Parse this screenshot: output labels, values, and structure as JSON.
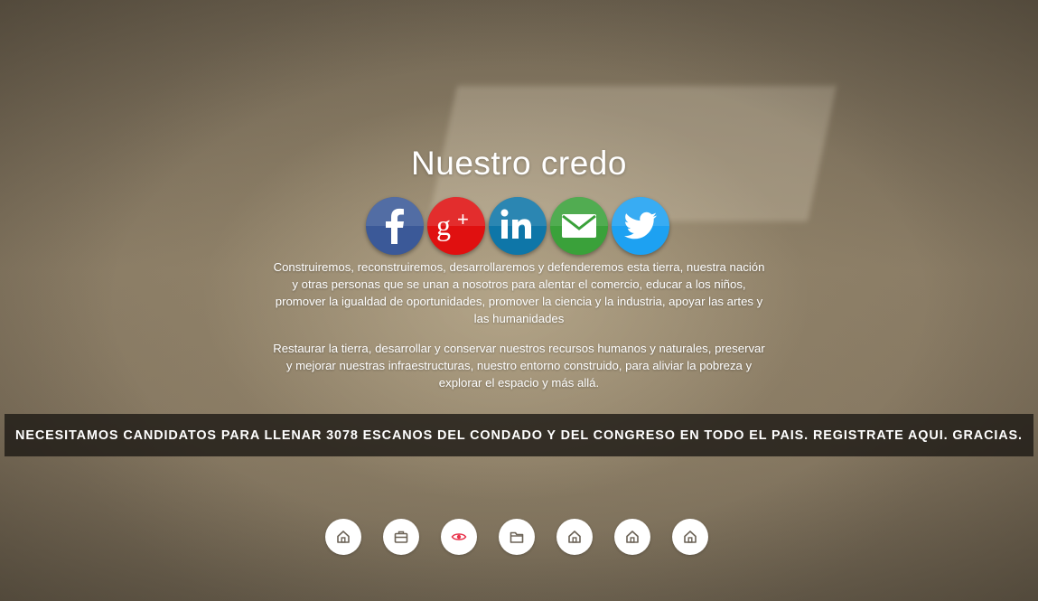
{
  "title": "Nuestro credo",
  "social": [
    {
      "name": "facebook",
      "icon": "facebook-icon",
      "color": "#3b5998"
    },
    {
      "name": "google-plus",
      "icon": "google-plus-icon",
      "color": "#dd1111"
    },
    {
      "name": "linkedin",
      "icon": "linkedin-icon",
      "color": "#0e76a8"
    },
    {
      "name": "email",
      "icon": "mail-icon",
      "color": "#3aa13a"
    },
    {
      "name": "twitter",
      "icon": "twitter-icon",
      "color": "#1da1f2"
    }
  ],
  "paragraph1": "Construiremos, reconstruiremos, desarrollaremos y defenderemos esta tierra, nuestra nación y otras personas que se unan a nosotros para alentar el comercio, educar a los niños, promover la igualdad de oportunidades, promover la ciencia y la industria, apoyar las artes y las humanidades",
  "paragraph2": "Restaurar la tierra, desarrollar y conservar nuestros recursos humanos y naturales, preservar y mejorar nuestras infraestructuras, nuestro entorno construido, para aliviar la pobreza y explorar el espacio y más allá.",
  "banner": "NECESITAMOS CANDIDATOS PARA LLENAR 3078 ESCANOS DEL CONDADO Y DEL CONGRESO EN TODO EL PAIS. REGISTRATE AQUI. GRACIAS.",
  "nav_dots": [
    {
      "icon": "home-icon",
      "active": false
    },
    {
      "icon": "briefcase-icon",
      "active": false
    },
    {
      "icon": "eye-icon",
      "active": true
    },
    {
      "icon": "folder-icon",
      "active": false
    },
    {
      "icon": "home-icon",
      "active": false
    },
    {
      "icon": "home-icon",
      "active": false
    },
    {
      "icon": "home-icon",
      "active": false
    }
  ],
  "colors": {
    "icon_default": "#6b6256",
    "icon_active": "#e8324a"
  }
}
